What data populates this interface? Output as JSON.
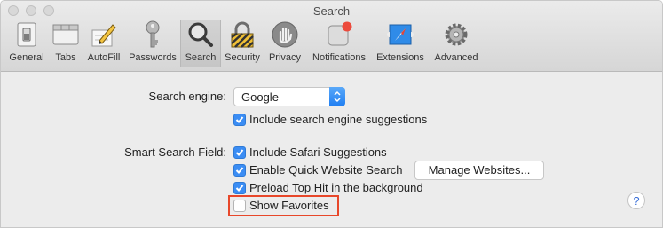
{
  "window": {
    "title": "Search"
  },
  "toolbar": {
    "tabs": [
      {
        "label": "General",
        "icon": "general-switch-icon"
      },
      {
        "label": "Tabs",
        "icon": "tabs-icon"
      },
      {
        "label": "AutoFill",
        "icon": "autofill-pencil-icon"
      },
      {
        "label": "Passwords",
        "icon": "key-icon"
      },
      {
        "label": "Search",
        "icon": "magnifier-icon",
        "selected": true
      },
      {
        "label": "Security",
        "icon": "padlock-icon"
      },
      {
        "label": "Privacy",
        "icon": "hand-icon"
      },
      {
        "label": "Notifications",
        "icon": "notifications-icon"
      },
      {
        "label": "Extensions",
        "icon": "compass-icon"
      },
      {
        "label": "Advanced",
        "icon": "gear-icon"
      }
    ]
  },
  "search": {
    "engine_label": "Search engine:",
    "engine_value": "Google",
    "include_suggestions": {
      "label": "Include search engine suggestions",
      "checked": true
    }
  },
  "smart": {
    "label": "Smart Search Field:",
    "options": [
      {
        "label": "Include Safari Suggestions",
        "checked": true
      },
      {
        "label": "Enable Quick Website Search",
        "checked": true
      },
      {
        "label": "Preload Top Hit in the background",
        "checked": true
      },
      {
        "label": "Show Favorites",
        "checked": false
      }
    ],
    "manage_button": "Manage Websites..."
  },
  "help": {
    "label": "?"
  },
  "colors": {
    "accent": "#3b8df4",
    "highlight": "#e8472a"
  }
}
